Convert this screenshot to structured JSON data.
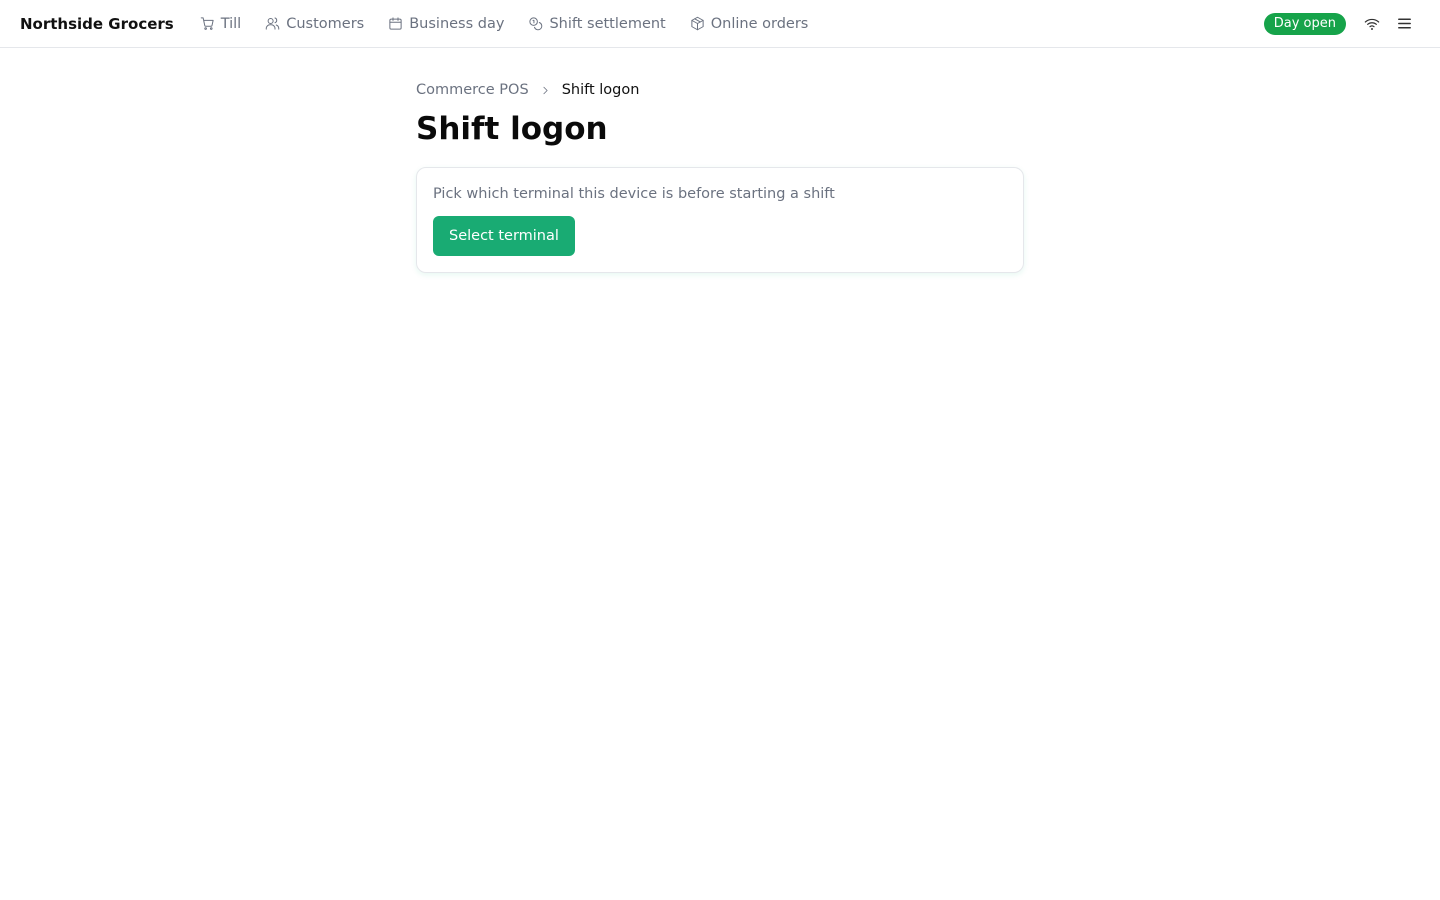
{
  "app": {
    "brand": "Northside Grocers"
  },
  "nav": {
    "items": [
      {
        "label": "Till",
        "icon": "cart-icon"
      },
      {
        "label": "Customers",
        "icon": "users-icon"
      },
      {
        "label": "Business day",
        "icon": "calendar-icon"
      },
      {
        "label": "Shift settlement",
        "icon": "coins-icon"
      },
      {
        "label": "Online orders",
        "icon": "package-icon"
      }
    ]
  },
  "status": {
    "label": "Day open",
    "color": "#16a34a"
  },
  "topbar_icons": [
    "wifi-icon",
    "menu-icon"
  ],
  "breadcrumb": {
    "parent": "Commerce POS",
    "current": "Shift logon"
  },
  "page": {
    "title": "Shift logon"
  },
  "card": {
    "text": "Pick which terminal this device is before starting a shift",
    "button_label": "Select terminal",
    "button_color": "#19ab73"
  }
}
